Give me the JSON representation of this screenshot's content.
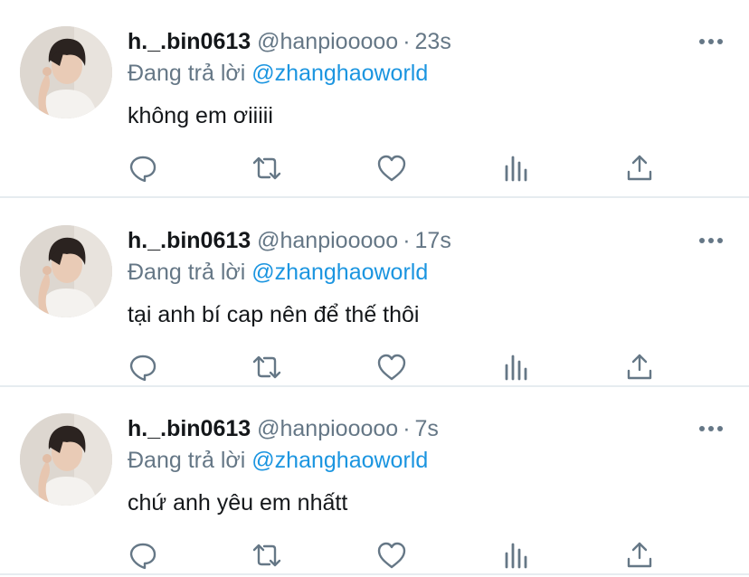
{
  "tweets": [
    {
      "display_name": "h._.bin0613",
      "handle": "@hanpiooooo",
      "separator": "·",
      "time": "23s",
      "reply_prefix": "Đang trả lời",
      "reply_to": "@zhanghaoworld",
      "text": "không em ơiiiii"
    },
    {
      "display_name": "h._.bin0613",
      "handle": "@hanpiooooo",
      "separator": "·",
      "time": "17s",
      "reply_prefix": "Đang trả lời",
      "reply_to": "@zhanghaoworld",
      "text": "tại anh bí cap nên để thế thôi"
    },
    {
      "display_name": "h._.bin0613",
      "handle": "@hanpiooooo",
      "separator": "·",
      "time": "7s",
      "reply_prefix": "Đang trả lời",
      "reply_to": "@zhanghaoworld",
      "text": "chứ anh yêu em nhấtt"
    }
  ],
  "icons": {
    "more": "more-horizontal-icon",
    "reply": "reply-icon",
    "retweet": "retweet-icon",
    "like": "heart-icon",
    "stats": "analytics-icon",
    "share": "share-icon"
  },
  "colors": {
    "text": "#14171a",
    "muted": "#657786",
    "link": "#1b95e0",
    "divider": "#e6ecf0"
  }
}
